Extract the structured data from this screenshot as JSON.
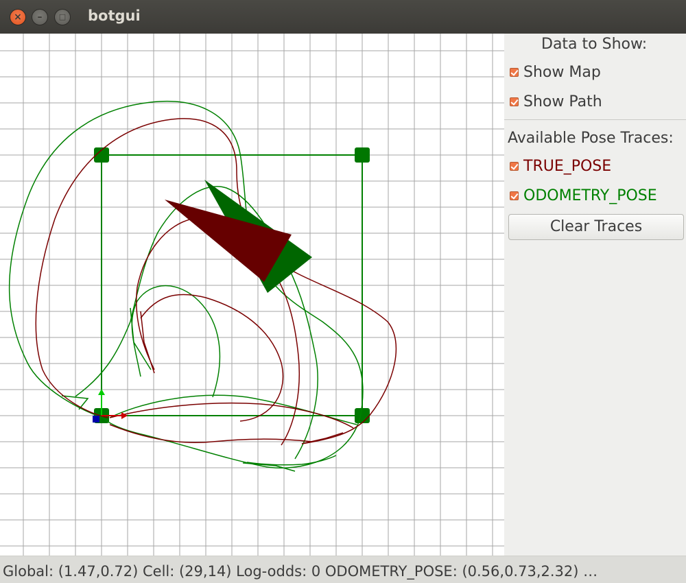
{
  "window": {
    "title": "botgui"
  },
  "panel": {
    "data_heading": "Data to Show:",
    "show_map": {
      "label": "Show Map",
      "checked": true
    },
    "show_path": {
      "label": "Show Path",
      "checked": true
    },
    "traces_heading": "Available Pose Traces:",
    "traces": [
      {
        "label": "TRUE_POSE",
        "checked": true,
        "color": "#7a0000"
      },
      {
        "label": "ODOMETRY_POSE",
        "checked": true,
        "color": "#008000"
      }
    ],
    "clear_button": "Clear Traces"
  },
  "statusbar": {
    "text": "Global: (1.47,0.72) Cell: (29,14) Log-odds: 0    ODOMETRY_POSE: (0.56,0.73,2.32)  …"
  },
  "colors": {
    "true_pose": "#660000",
    "odometry_pose": "#006600",
    "path": "#008000",
    "grid": "#a0a0a0"
  },
  "icons": [
    "close-icon",
    "minimize-icon",
    "maximize-icon"
  ]
}
